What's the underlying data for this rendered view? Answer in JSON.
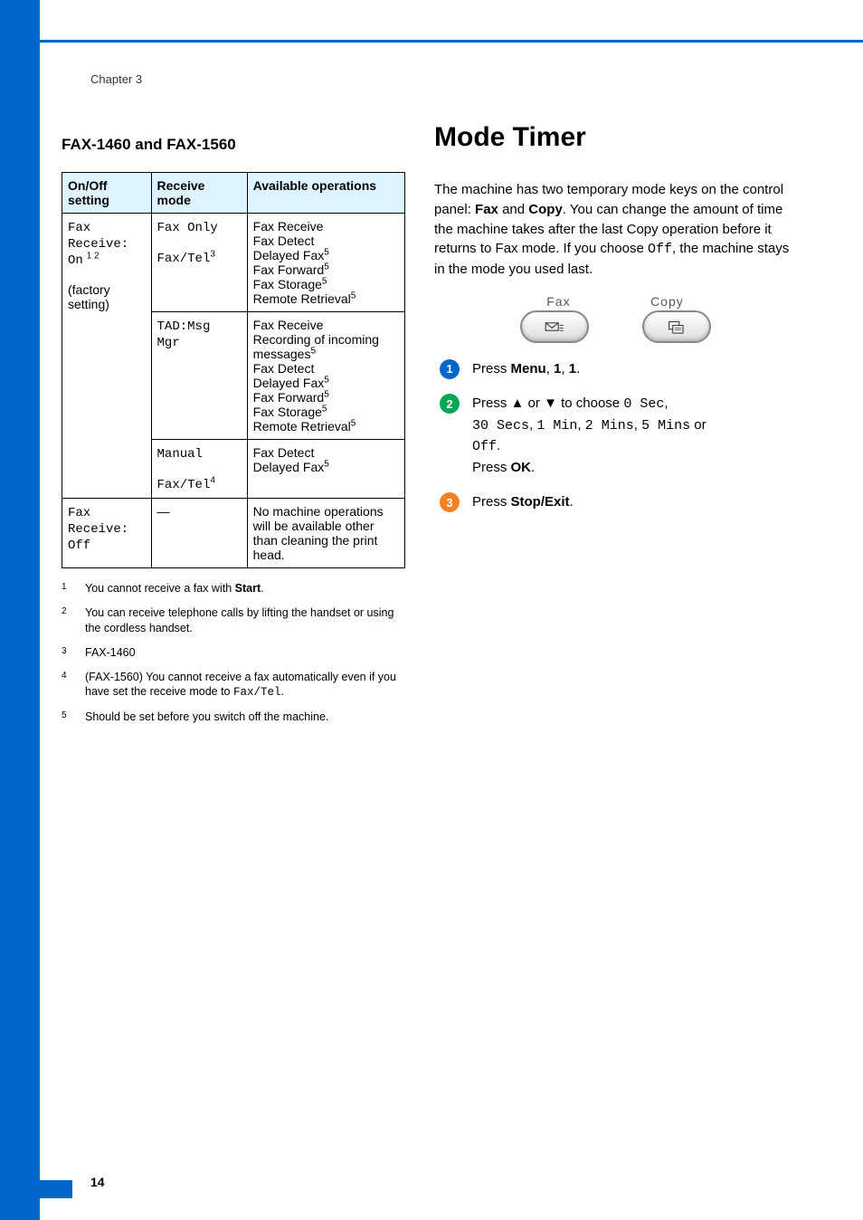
{
  "chapter": "Chapter 3",
  "page_number": "14",
  "left": {
    "heading": "FAX-1460 and FAX-1560",
    "table": {
      "head": [
        "On/Off setting",
        "Receive mode",
        "Available operations"
      ],
      "rows": [
        {
          "setting_lines": [
            "Fax",
            "Receive:",
            "On"
          ],
          "setting_sup": "1 2",
          "setting_tail": "(factory setting)",
          "mode_line1": "Fax Only",
          "mode_line2": "Fax/Tel",
          "mode_sup": "3",
          "ops": [
            "Fax Receive",
            "Fax Detect",
            "Delayed Fax",
            "Fax Forward",
            "Fax Storage",
            "Remote Retrieval"
          ],
          "ops_sup": [
            "",
            "",
            "5",
            "5",
            "5",
            "5"
          ]
        },
        {
          "mode_line1": "TAD:Msg",
          "mode_line2": "Mgr",
          "ops": [
            "Fax Receive",
            "Recording of incoming messages",
            "Fax Detect",
            "Delayed Fax",
            "Fax Forward",
            "Fax Storage",
            "Remote Retrieval"
          ],
          "ops_sup": [
            "",
            "5",
            "",
            "5",
            "5",
            "5",
            "5"
          ]
        },
        {
          "mode_line1": "Manual",
          "mode_line2": "Fax/Tel",
          "mode_sup": "4",
          "ops": [
            "Fax Detect",
            "Delayed Fax"
          ],
          "ops_sup": [
            "",
            "5"
          ]
        },
        {
          "setting_lines": [
            "Fax",
            "Receive:",
            "Off"
          ],
          "mode": "—",
          "ops_text": "No machine operations will be available other than cleaning the print head."
        }
      ]
    },
    "footnotes": [
      {
        "n": "1",
        "plain_a": "You cannot receive a fax with ",
        "bold": "Start",
        "plain_b": "."
      },
      {
        "n": "2",
        "plain_a": "You can receive telephone calls by lifting the handset or using the cordless handset.",
        "bold": "",
        "plain_b": ""
      },
      {
        "n": "3",
        "plain_a": "FAX-1460",
        "bold": "",
        "plain_b": ""
      },
      {
        "n": "4",
        "plain_a": "(FAX-1560) You cannot receive a fax automatically even if you have set the receive mode to ",
        "mono": "Fax/Tel",
        "plain_b": "."
      },
      {
        "n": "5",
        "plain_a": "Should be set before you switch off the machine.",
        "bold": "",
        "plain_b": ""
      }
    ]
  },
  "right": {
    "heading": "Mode Timer",
    "para_a": "The machine has two temporary mode keys on the control panel: ",
    "para_b": "Fax",
    "para_c": " and ",
    "para_d": "Copy",
    "para_e": ". You can change the amount of time the machine takes after the last Copy operation before it returns to Fax mode. If you choose ",
    "para_f_mono": "Off",
    "para_g": ", the machine stays in the mode you used last.",
    "key_labels": [
      "Fax",
      "Copy"
    ],
    "steps": {
      "s1_a": "Press ",
      "s1_b": "Menu",
      "s1_c": ", ",
      "s1_d": "1",
      "s1_e": ", ",
      "s1_f": "1",
      "s1_g": ".",
      "s2_a": "Press ",
      "s2_b": "▲",
      "s2_c": " or ",
      "s2_d": "▼",
      "s2_e": " to choose ",
      "s2_f_mono": "0 Sec",
      "s2_g": ", ",
      "s2_h_mono": "30 Secs",
      "s2_i": ", ",
      "s2_j_mono": "1 Min",
      "s2_k": ", ",
      "s2_l_mono": "2 Mins",
      "s2_m": ", ",
      "s2_n_mono": "5 Mins",
      "s2_o": " or ",
      "s2_p_mono": "Off",
      "s2_q": ".",
      "s2_r": "Press ",
      "s2_s": "OK",
      "s2_t": ".",
      "s3_a": "Press ",
      "s3_b": "Stop/Exit",
      "s3_c": "."
    }
  }
}
